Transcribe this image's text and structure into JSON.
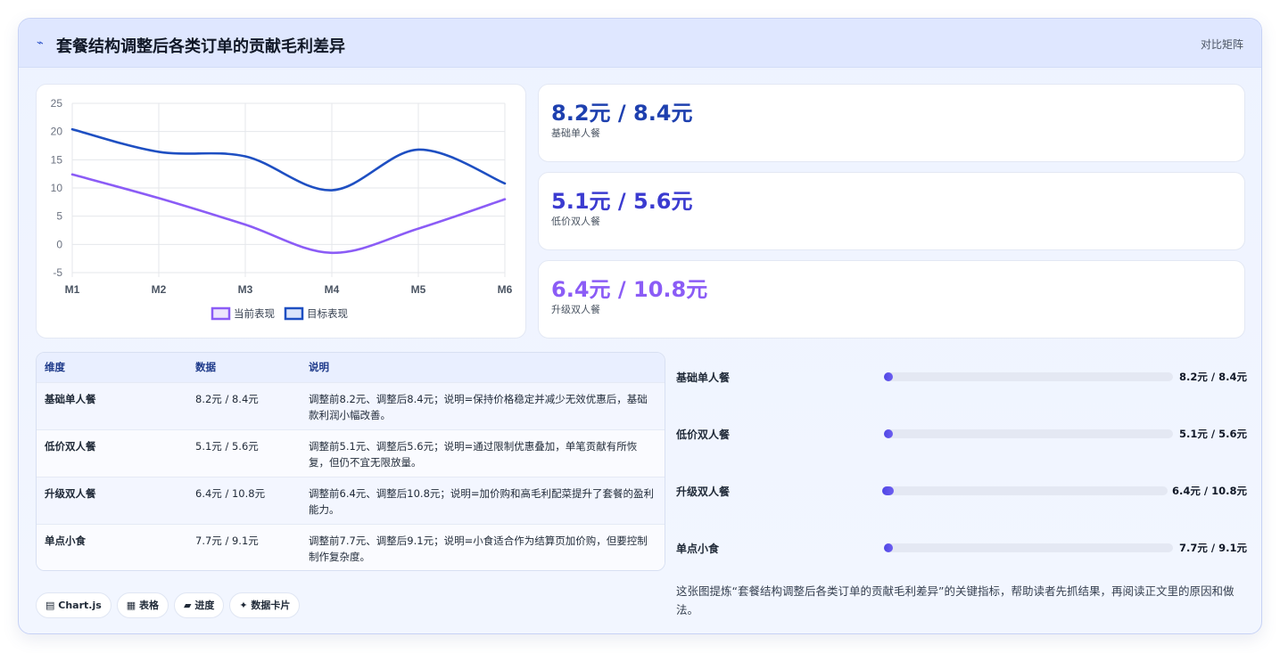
{
  "header": {
    "icon": "pulse-icon",
    "icon_glyph": "⌁",
    "title": "套餐结构调整后各类订单的贡献毛利差异",
    "right_label": "对比矩阵"
  },
  "chart_data": {
    "type": "line",
    "categories": [
      "M1",
      "M2",
      "M3",
      "M4",
      "M5",
      "M6"
    ],
    "ylim": [
      -5,
      25
    ],
    "yticks": [
      25,
      20,
      15,
      10,
      5,
      0,
      -5
    ],
    "grid": true,
    "legend_position": "bottom",
    "series": [
      {
        "name": "当前表现",
        "values": [
          12.4,
          8.2,
          3.5,
          -1.5,
          2.8,
          8.0
        ],
        "color": "#8b5cf6"
      },
      {
        "name": "目标表现",
        "values": [
          20.4,
          16.4,
          15.6,
          9.6,
          16.8,
          10.8
        ],
        "color": "#1e4fc2"
      }
    ]
  },
  "kpis": [
    {
      "value": "8.2元 / 8.4元",
      "label": "基础单人餐",
      "color": "#1e40af"
    },
    {
      "value": "5.1元 / 5.6元",
      "label": "低价双人餐",
      "color": "#3b3bd0"
    },
    {
      "value": "6.4元 / 10.8元",
      "label": "升级双人餐",
      "color": "#8b5cf6"
    }
  ],
  "table": {
    "headers": [
      "维度",
      "数据",
      "说明"
    ],
    "rows": [
      [
        "基础单人餐",
        "8.2元 / 8.4元",
        "调整前8.2元、调整后8.4元；说明=保持价格稳定并减少无效优惠后，基础款利润小幅改善。"
      ],
      [
        "低价双人餐",
        "5.1元 / 5.6元",
        "调整前5.1元、调整后5.6元；说明=通过限制优惠叠加，单笔贡献有所恢复，但仍不宜无限放量。"
      ],
      [
        "升级双人餐",
        "6.4元 / 10.8元",
        "调整前6.4元、调整后10.8元；说明=加价购和高毛利配菜提升了套餐的盈利能力。"
      ],
      [
        "单点小食",
        "7.7元 / 9.1元",
        "调整前7.7元、调整后9.1元；说明=小食适合作为结算页加价购，但要控制制作复杂度。"
      ]
    ]
  },
  "progress": [
    {
      "label": "基础单人餐",
      "value": "8.2元 / 8.4元",
      "fill": 0.03
    },
    {
      "label": "低价双人餐",
      "value": "5.1元 / 5.6元",
      "fill": 0.03
    },
    {
      "label": "升级双人餐",
      "value": "6.4元 / 10.8元",
      "fill": 0.04
    },
    {
      "label": "单点小食",
      "value": "7.7元 / 9.1元",
      "fill": 0.03
    }
  ],
  "description": "这张图提炼“套餐结构调整后各类订单的贡献毛利差异”的关键指标，帮助读者先抓结果，再阅读正文里的原因和做法。",
  "chips": [
    {
      "icon": "▤",
      "label": "Chart.js"
    },
    {
      "icon": "▦",
      "label": "表格"
    },
    {
      "icon": "▰",
      "label": "进度"
    },
    {
      "icon": "✦",
      "label": "数据卡片"
    }
  ]
}
